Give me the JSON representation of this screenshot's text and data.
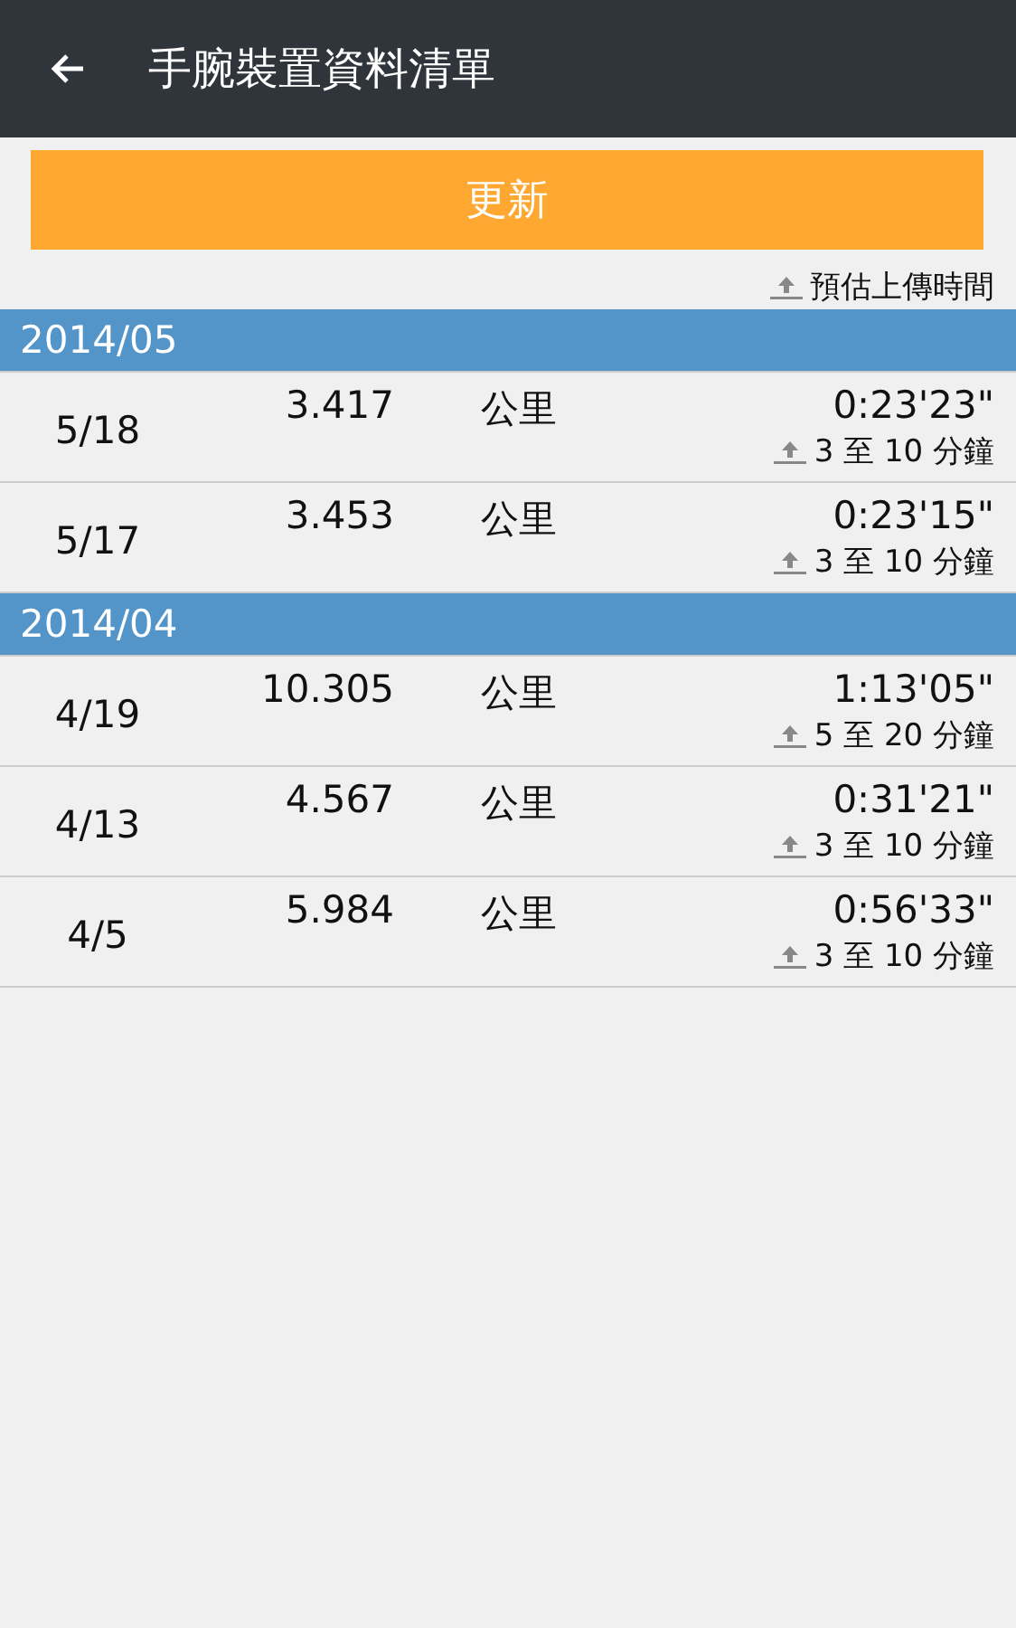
{
  "app_bar": {
    "title": "手腕裝置資料清單"
  },
  "update_button": {
    "label": "更新"
  },
  "legend": {
    "label": "預估上傳時間"
  },
  "groups": [
    {
      "month": "2014/05",
      "rows": [
        {
          "date": "5/18",
          "distance": "3.417",
          "unit": "公里",
          "duration": "0:23'23\"",
          "estimate": "3 至 10 分鐘"
        },
        {
          "date": "5/17",
          "distance": "3.453",
          "unit": "公里",
          "duration": "0:23'15\"",
          "estimate": "3 至 10 分鐘"
        }
      ]
    },
    {
      "month": "2014/04",
      "rows": [
        {
          "date": "4/19",
          "distance": "10.305",
          "unit": "公里",
          "duration": "1:13'05\"",
          "estimate": "5 至 20 分鐘"
        },
        {
          "date": "4/13",
          "distance": "4.567",
          "unit": "公里",
          "duration": "0:31'21\"",
          "estimate": "3 至 10 分鐘"
        },
        {
          "date": "4/5",
          "distance": "5.984",
          "unit": "公里",
          "duration": "0:56'33\"",
          "estimate": "3 至 10 分鐘"
        }
      ]
    }
  ]
}
